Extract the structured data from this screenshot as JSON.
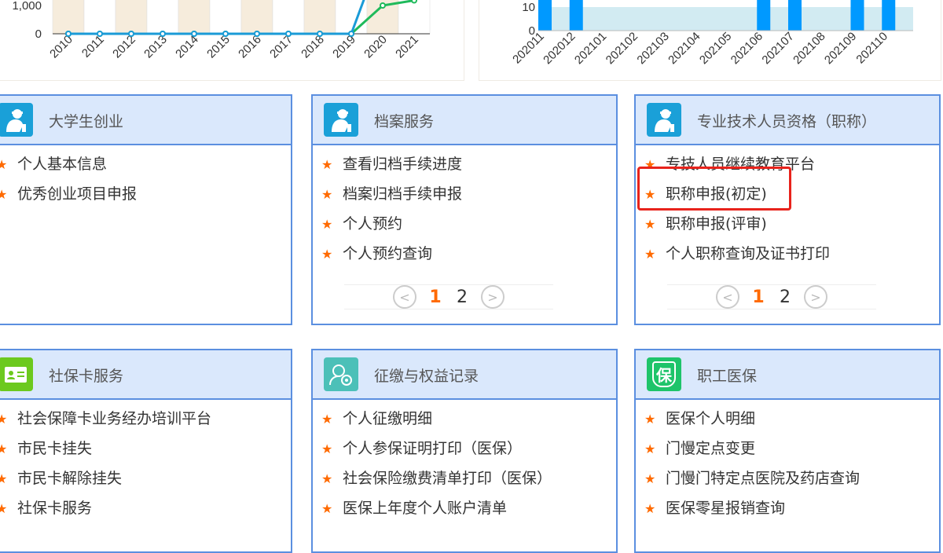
{
  "chart_data": [
    {
      "type": "line",
      "categories": [
        "2010",
        "2011",
        "2012",
        "2013",
        "2014",
        "2015",
        "2016",
        "2017",
        "2018",
        "2019",
        "2020",
        "2021"
      ],
      "yticks": [
        "0",
        "1,000"
      ],
      "ylim": [
        0,
        1200
      ],
      "series": [
        {
          "name": "blue",
          "color": "#1a9bd7",
          "values": [
            0,
            0,
            0,
            0,
            0,
            0,
            0,
            0,
            0,
            0,
            3000,
            5000
          ]
        },
        {
          "name": "green",
          "color": "#1fba5b",
          "values": [
            0,
            0,
            0,
            0,
            0,
            0,
            0,
            0,
            0,
            0,
            1000,
            1180
          ]
        }
      ]
    },
    {
      "type": "bar",
      "categories": [
        "202011",
        "202012",
        "202101",
        "202102",
        "202103",
        "202104",
        "202105",
        "202106",
        "202107",
        "202108",
        "202109",
        "202110"
      ],
      "yticks": [
        "0",
        "10"
      ],
      "ylim": [
        0,
        12
      ],
      "band_value": 10,
      "values": [
        20,
        20,
        0,
        0,
        0,
        0,
        0,
        20,
        20,
        0,
        20,
        20
      ],
      "color": "#0099ff"
    }
  ],
  "cards": [
    {
      "title": "大学生创业",
      "icon": "person-icon",
      "icon_color": "#1aa0d8",
      "items": [
        "个人基本信息",
        "优秀创业项目申报"
      ]
    },
    {
      "title": "档案服务",
      "icon": "person-icon",
      "icon_color": "#1aa0d8",
      "items": [
        "查看归档手续进度",
        "档案归档手续申报",
        "个人预约",
        "个人预约查询"
      ],
      "pages": [
        "1",
        "2"
      ]
    },
    {
      "title": "专业技术人员资格（职称）",
      "icon": "person-icon",
      "icon_color": "#1aa0d8",
      "items": [
        "专技人员继续教育平台",
        "职称申报(初定)",
        "职称申报(评审)",
        "个人职称查询及证书打印"
      ],
      "pages": [
        "1",
        "2"
      ]
    },
    {
      "title": "社保卡服务",
      "icon": "id-card-icon",
      "icon_color": "#6cc91e",
      "items": [
        "社会保障卡业务经办培训平台",
        "市民卡挂失",
        "市民卡解除挂失",
        "社保卡服务"
      ]
    },
    {
      "title": "征缴与权益记录",
      "icon": "user-view-icon",
      "icon_color": "#4cc0b8",
      "items": [
        "个人征缴明细",
        "个人参保证明打印（医保）",
        "社会保险缴费清单打印（医保）",
        "医保上年度个人账户清单"
      ]
    },
    {
      "title": "职工医保",
      "icon": "shield-icon",
      "icon_color": "#1ec46a",
      "icon_text": "保",
      "items": [
        "医保个人明细",
        "门慢定点变更",
        "门慢门特定点医院及药店查询",
        "医保零星报销查询"
      ]
    }
  ],
  "pager": {
    "prev": "<",
    "next": ">"
  }
}
